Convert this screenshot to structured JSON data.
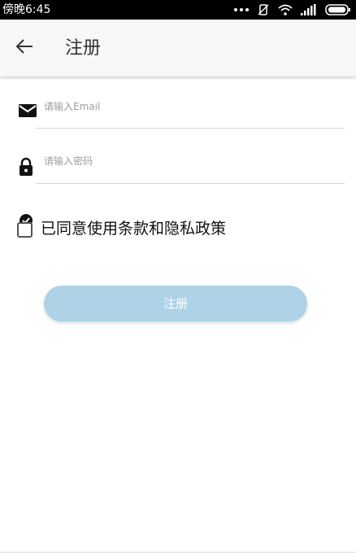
{
  "status_bar": {
    "time": "傍晚6:45",
    "icons": [
      "more-dots-icon",
      "mute-icon",
      "wifi-icon",
      "signal-icon",
      "battery-icon"
    ]
  },
  "app_bar": {
    "back_icon": "arrow-left-icon",
    "title": "注册"
  },
  "form": {
    "email": {
      "icon": "email-icon",
      "placeholder": "请输入Email",
      "value": ""
    },
    "password": {
      "icon": "lock-icon",
      "placeholder": "请输入密码",
      "value": ""
    },
    "agree": {
      "label": "已同意使用条款和隐私政策",
      "checked": false
    },
    "submit_label": "注册"
  },
  "colors": {
    "status_bar_bg": "#000000",
    "app_bar_bg": "#f7f7f7",
    "button_bg": "#aed3e6",
    "button_text": "#ffffff"
  }
}
